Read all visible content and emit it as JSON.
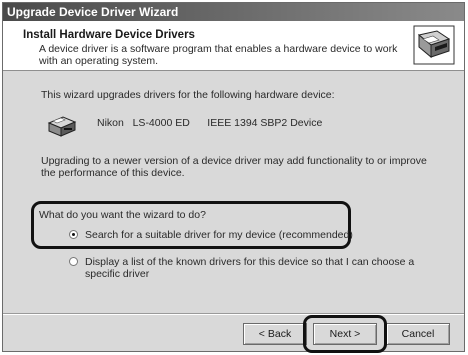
{
  "window": {
    "title": "Upgrade Device Driver Wizard"
  },
  "header": {
    "title": "Install Hardware Device Drivers",
    "description": "A device driver is a software program that enables a hardware device to work with an operating system.",
    "icon": "hardware-wizard-icon"
  },
  "body": {
    "intro": "This wizard upgrades drivers for the following hardware device:",
    "device": {
      "name": "Nikon   LS-4000 ED      IEEE 1394 SBP2 Device",
      "icon": "scanner-icon"
    },
    "upgrade_note": "Upgrading to a newer version of a device driver may add functionality to or improve the performance of this device.",
    "question": "What do you want the wizard to do?",
    "options": [
      {
        "label": "Search for a suitable driver for my device (recommended)",
        "selected": true
      },
      {
        "label": "Display a list of the known drivers for this device so that I can choose a specific driver",
        "selected": false
      }
    ]
  },
  "buttons": {
    "back": "< Back",
    "next": "Next >",
    "cancel": "Cancel"
  }
}
